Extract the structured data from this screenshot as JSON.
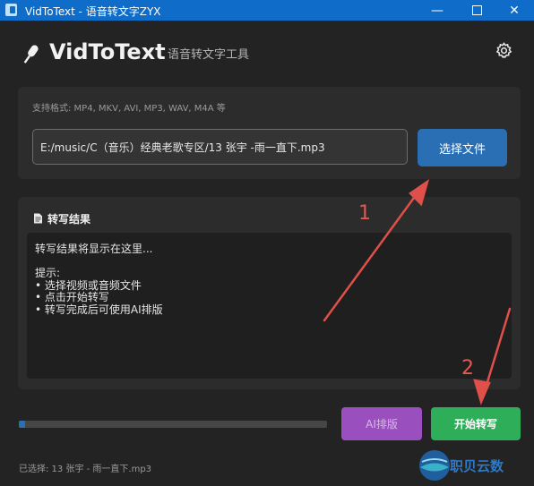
{
  "window": {
    "title": "VidToText - 语音转文字ZYX",
    "minimize_glyph": "—",
    "close_glyph": "✕"
  },
  "header": {
    "app_name": "VidToText",
    "subtitle": "语音转文字工具",
    "icons": {
      "app": "microphone-icon",
      "settings": "gear-icon"
    }
  },
  "file_select": {
    "formats_label": "支持格式: MP4, MKV, AVI, MP3, WAV, M4A 等",
    "path_value": "E:/music/C（音乐）经典老歌专区/13 张宇 -雨一直下.mp3",
    "choose_button": "选择文件"
  },
  "result": {
    "title": "转写结果",
    "text": "转写结果将显示在这里...\n\n提示:\n• 选择视频或音频文件\n• 点击开始转写\n• 转写完成后可使用AI排版"
  },
  "progress": {
    "fraction": 0.02
  },
  "actions": {
    "ai_button": "AI排版",
    "start_button": "开始转写"
  },
  "status": {
    "selected_text": "已选择: 13 张宇 - 雨一直下.mp3"
  },
  "watermark": {
    "text": "职贝云数"
  },
  "annotations": {
    "label_1": "1",
    "label_2": "2",
    "arrow_color": "#e0504a"
  },
  "colors": {
    "titlebar": "#0f6cc8",
    "accent_blue": "#2a6fb4",
    "ai_purple": "#9a4fbf",
    "start_green": "#2fae5a",
    "background": "#232323"
  }
}
